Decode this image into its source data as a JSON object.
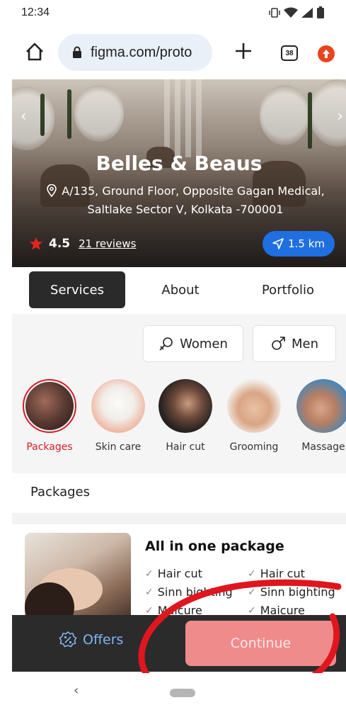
{
  "status_bar": {
    "time": "12:34"
  },
  "browser": {
    "url": "figma.com/proto",
    "tab_count": "38"
  },
  "hero": {
    "title": "Belles & Beaus",
    "address_line1": "A/135, Ground Floor, Opposite Gagan Medical,",
    "address_line2": "Saltlake Sector V, Kolkata -700001",
    "rating": "4.5",
    "reviews": "21 reviews",
    "distance": "1.5 km",
    "accent_color": "#1f6fe0",
    "star_color": "#e8231f"
  },
  "tabs": [
    {
      "label": "Services",
      "active": true
    },
    {
      "label": "About",
      "active": false
    },
    {
      "label": "Portfolio",
      "active": false
    }
  ],
  "gender_filters": [
    {
      "label": "Women",
      "icon": "female-symbol-icon"
    },
    {
      "label": "Men",
      "icon": "male-symbol-icon"
    }
  ],
  "categories": [
    {
      "label": "Packages",
      "selected": true
    },
    {
      "label": "Skin care",
      "selected": false
    },
    {
      "label": "Hair cut",
      "selected": false
    },
    {
      "label": "Grooming",
      "selected": false
    },
    {
      "label": "Massage",
      "selected": false
    }
  ],
  "section_title": "Packages",
  "package": {
    "title": "All in one package",
    "items_left": [
      "Hair cut",
      "Sinn bighting",
      "Maicure"
    ],
    "items_right": [
      "Hair cut",
      "Sinn bighting",
      "Maicure"
    ]
  },
  "bottom_bar": {
    "offers_label": "Offers",
    "continue_label": "Continue",
    "continue_color": "#f08b8b"
  }
}
